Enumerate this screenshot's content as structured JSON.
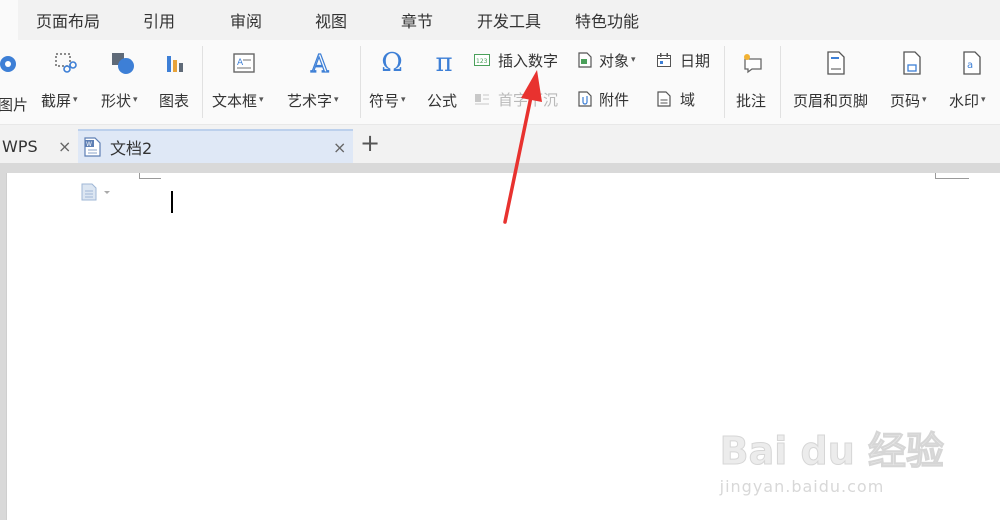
{
  "menu": {
    "tabs": [
      "页面布局",
      "引用",
      "审阅",
      "视图",
      "章节",
      "开发工具",
      "特色功能"
    ]
  },
  "ribbon": {
    "picture_label": "图片",
    "screenshot_label": "截屏",
    "shapes_label": "形状",
    "chart_label": "图表",
    "textbox_label": "文本框",
    "wordart_label": "艺术字",
    "symbol_label": "符号",
    "symbol_glyph": "Ω",
    "formula_label": "公式",
    "formula_glyph": "π",
    "insert_number_label": "插入数字",
    "dropcap_label": "首字下沉",
    "object_label": "对象",
    "attachment_label": "附件",
    "date_label": "日期",
    "field_label": "域",
    "comment_label": "批注",
    "header_footer_label": "页眉和页脚",
    "page_number_label": "页码",
    "watermark_label": "水印",
    "caret": "▾"
  },
  "tabs": {
    "wps_label": "WPS",
    "doc_label": "文档2",
    "close_glyph": "×",
    "new_tab_glyph": "+"
  },
  "watermark": {
    "brand": "Bai du 经验",
    "url": "jingyan.baidu.com"
  },
  "colors": {
    "accent": "#3d7fd6",
    "arrow": "#e8322f"
  }
}
